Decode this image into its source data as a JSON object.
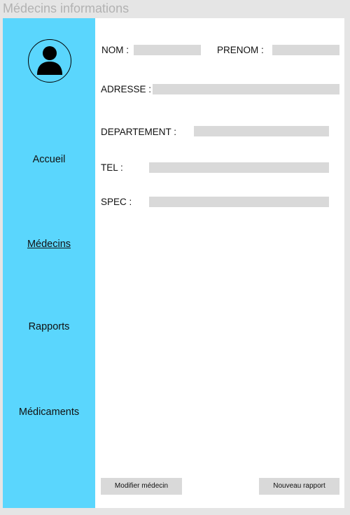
{
  "window": {
    "title": "Médecins informations"
  },
  "sidebar": {
    "avatar_icon": "user-avatar-icon",
    "background": "#5ad6fd",
    "items": [
      {
        "label": "Accueil",
        "active": false
      },
      {
        "label": "Médecins",
        "active": true
      },
      {
        "label": "Rapports",
        "active": false
      },
      {
        "label": "Médicaments",
        "active": false
      }
    ]
  },
  "form": {
    "nom_label": "NOM :",
    "prenom_label": "PRENOM :",
    "adresse_label": "ADRESSE :",
    "departement_label": "DEPARTEMENT :",
    "tel_label": "TEL :",
    "spec_label": "SPEC :",
    "nom_value": "",
    "prenom_value": "",
    "adresse_value": "",
    "departement_value": "",
    "tel_value": "",
    "spec_value": ""
  },
  "actions": {
    "modify_label": "Modifier médecin",
    "new_report_label": "Nouveau rapport"
  }
}
